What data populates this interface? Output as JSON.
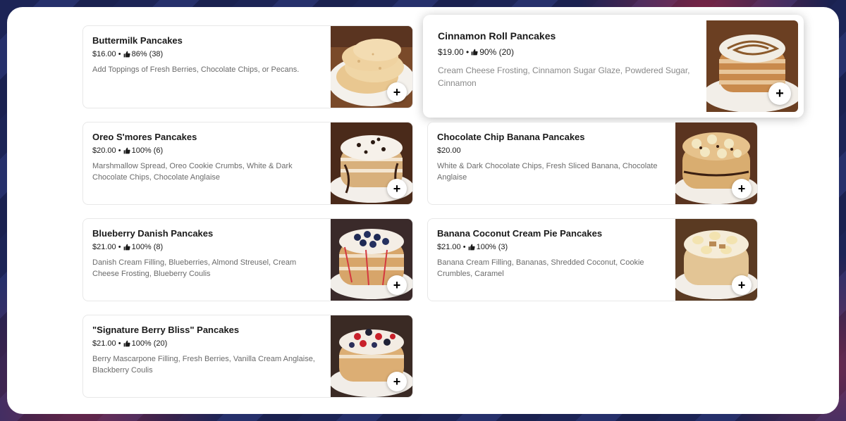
{
  "menu": {
    "items": [
      {
        "title": "Buttermilk Pancakes",
        "price": "$16.00",
        "rating": "86% (38)",
        "description": "Add Toppings of Fresh Berries, Chocolate Chips, or Pecans.",
        "add_label": "+"
      },
      {
        "title": "Cinnamon Roll Pancakes",
        "price": "$19.00",
        "rating": "90% (20)",
        "description": "Cream Cheese Frosting, Cinnamon Sugar Glaze, Powdered Sugar, Cinnamon",
        "add_label": "+"
      },
      {
        "title": "Oreo S'mores Pancakes",
        "price": "$20.00",
        "rating": "100% (6)",
        "description": "Marshmallow Spread, Oreo Cookie Crumbs, White & Dark Chocolate Chips, Chocolate Anglaise",
        "add_label": "+"
      },
      {
        "title": "Chocolate Chip Banana Pancakes",
        "price": "$20.00",
        "rating": "",
        "description": "White & Dark Chocolate Chips, Fresh Sliced Banana, Chocolate Anglaise",
        "add_label": "+"
      },
      {
        "title": "Blueberry Danish Pancakes",
        "price": "$21.00",
        "rating": "100% (8)",
        "description": "Danish Cream Filling, Blueberries, Almond Streusel, Cream Cheese Frosting, Blueberry Coulis",
        "add_label": "+"
      },
      {
        "title": "Banana Coconut Cream Pie Pancakes",
        "price": "$21.00",
        "rating": "100% (3)",
        "description": "Banana Cream Filling, Bananas, Shredded Coconut, Cookie Crumbles, Caramel",
        "add_label": "+"
      },
      {
        "title": "\"Signature Berry Bliss\" Pancakes",
        "price": "$21.00",
        "rating": "100% (20)",
        "description": "Berry Mascarpone Filling, Fresh Berries, Vanilla Cream Anglaise, Blackberry Coulis",
        "add_label": "+"
      }
    ]
  }
}
